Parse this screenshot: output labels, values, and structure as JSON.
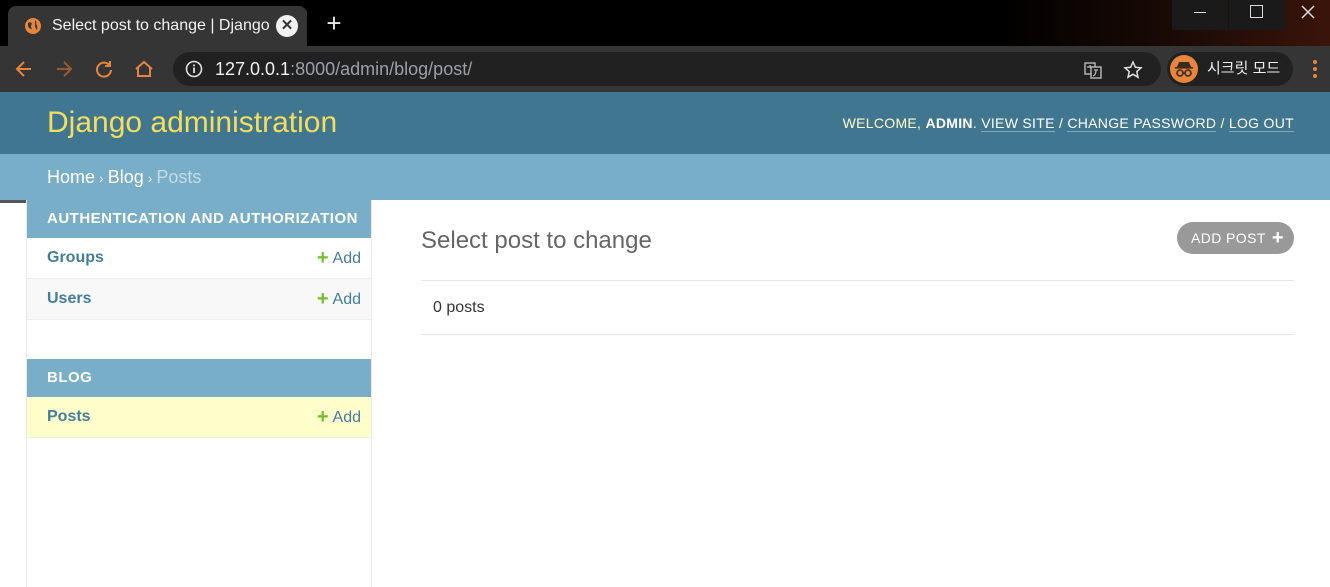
{
  "browser": {
    "tab": {
      "title": "Select post to change | Django site admin",
      "close": "✕"
    },
    "new_tab": "+",
    "url": {
      "host": "127.0.0.1",
      "rest": ":8000/admin/blog/post/"
    },
    "incognito_label": "시크릿 모드",
    "colors": {
      "tab_bg": "#353535",
      "toolbar_bg": "#353535",
      "accent": "#e8853c"
    }
  },
  "header": {
    "branding": "Django administration",
    "welcome": "WELCOME,",
    "username": "ADMIN",
    "view_site": "VIEW SITE",
    "change_password": "CHANGE PASSWORD",
    "log_out": "LOG OUT",
    "separator": "/"
  },
  "breadcrumbs": {
    "home": "Home",
    "app": "Blog",
    "current": "Posts",
    "sep": "›"
  },
  "sidebar": {
    "modules": [
      {
        "caption": "AUTHENTICATION AND AUTHORIZATION",
        "models": [
          {
            "name": "Groups",
            "add": "Add"
          },
          {
            "name": "Users",
            "add": "Add"
          }
        ]
      },
      {
        "caption": "BLOG",
        "models": [
          {
            "name": "Posts",
            "add": "Add",
            "selected": true
          }
        ]
      }
    ],
    "plus": "+"
  },
  "content": {
    "title": "Select post to change",
    "add_button": "ADD POST",
    "add_plus": "+",
    "result_count": "0 posts"
  },
  "colors": {
    "header_bg": "#417690",
    "branding": "#f5dd5d",
    "breadcrumbs_bg": "#79aec8",
    "link": "#447e9b",
    "add_green": "#70bf2b",
    "selected_row": "#ffffcc"
  }
}
